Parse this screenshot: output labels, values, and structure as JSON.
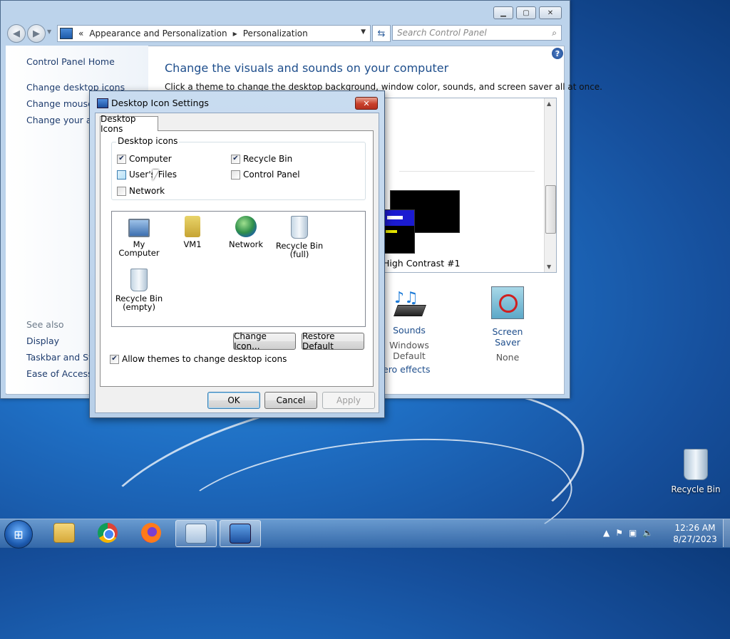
{
  "control_panel": {
    "breadcrumb": {
      "overflow": "«",
      "items": [
        "Appearance and Personalization",
        "Personalization"
      ]
    },
    "search_placeholder": "Search Control Panel",
    "left_links": [
      "Control Panel Home",
      "Change desktop icons",
      "Change mouse p",
      "Change your acc"
    ],
    "see_also": {
      "title": "See also",
      "links": [
        "Display",
        "Taskbar and Star",
        "Ease of Access C"
      ]
    },
    "heading": "Change the visuals and sounds on your computer",
    "subheading": "Click a theme to change the desktop background, window color, sounds, and screen saver all at once.",
    "theme_label": "High Contrast #1",
    "sounds": {
      "label": "Sounds",
      "value": "Windows Default"
    },
    "screensaver": {
      "label": "Screen Saver",
      "value": "None"
    },
    "aero_link": "ero effects"
  },
  "dialog": {
    "title": "Desktop Icon Settings",
    "tab": "Desktop Icons",
    "group_title": "Desktop icons",
    "checkboxes": [
      {
        "label": "Computer",
        "checked": true
      },
      {
        "label": "Recycle Bin",
        "checked": true
      },
      {
        "label": "User's Files",
        "checked": false
      },
      {
        "label": "Control Panel",
        "checked": false
      },
      {
        "label": "Network",
        "checked": false
      }
    ],
    "icons": [
      {
        "name": "My Computer",
        "icon": "computer-icon"
      },
      {
        "name": "VM1",
        "icon": "user-folder-icon"
      },
      {
        "name": "Network",
        "icon": "network-icon"
      },
      {
        "name": "Recycle Bin (full)",
        "line1": "Recycle Bin",
        "line2": "(full)",
        "icon": "recycle-bin-full-icon"
      },
      {
        "name": "Recycle Bin (empty)",
        "line1": "Recycle Bin",
        "line2": "(empty)",
        "icon": "recycle-bin-empty-icon"
      }
    ],
    "change_icon_button": "Change Icon...",
    "restore_default_button": "Restore Default",
    "allow_themes_label": "Allow themes to change desktop icons",
    "allow_themes_checked": true,
    "ok_button": "OK",
    "cancel_button": "Cancel",
    "apply_button": "Apply"
  },
  "desktop": {
    "recycle_bin_label": "Recycle Bin"
  },
  "taskbar": {
    "apps": [
      "file-explorer-icon",
      "chrome-icon",
      "firefox-icon",
      "control-panel-icon",
      "display-settings-icon"
    ],
    "time": "12:26 AM",
    "date": "8/27/2023"
  }
}
